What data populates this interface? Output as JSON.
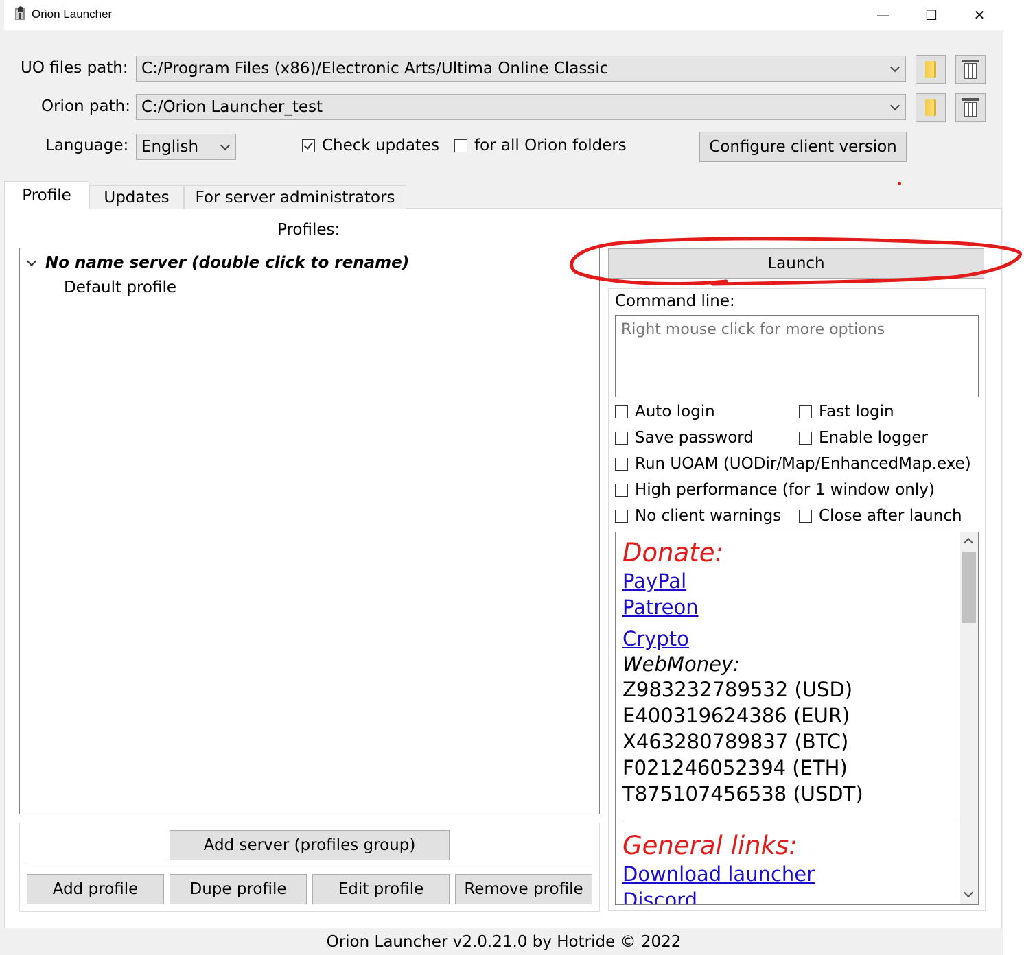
{
  "window": {
    "title": "Orion Launcher",
    "minimize_glyph": "—",
    "maximize_glyph": "☐",
    "close_glyph": "✕"
  },
  "paths": {
    "uo_label": "UO files path:",
    "uo_value": "C:/Program Files (x86)/Electronic Arts/Ultima Online Classic",
    "orion_label": "Orion path:",
    "orion_value": "C:/Orion Launcher_test",
    "browse_icon": "folder-icon",
    "clear_icon": "trash-icon"
  },
  "language": {
    "label": "Language:",
    "value": "English"
  },
  "options_top": {
    "check_updates": {
      "label": "Check updates",
      "checked": true
    },
    "all_folders": {
      "label": "for all Orion folders",
      "checked": false
    },
    "configure_label": "Configure client version"
  },
  "tabs": [
    {
      "label": "Profile",
      "active": true
    },
    {
      "label": "Updates",
      "active": false
    },
    {
      "label": "For server administrators",
      "active": false
    }
  ],
  "profiles": {
    "label": "Profiles:",
    "server_name": "No name server (double click to rename)",
    "profile_name": "Default profile"
  },
  "buttons": {
    "add_server": "Add server (profiles group)",
    "add_profile": "Add profile",
    "dupe_profile": "Dupe profile",
    "edit_profile": "Edit profile",
    "remove_profile": "Remove profile",
    "launch": "Launch"
  },
  "command_line": {
    "label": "Command line:",
    "placeholder": "Right mouse click for more options"
  },
  "launch_options": {
    "auto_login": "Auto login",
    "fast_login": "Fast login",
    "save_password": "Save password",
    "enable_logger": "Enable logger",
    "run_uoam": "Run UOAM (UODir/Map/EnhancedMap.exe)",
    "high_performance": "High performance (for 1 window only)",
    "no_client_warnings": "No client warnings",
    "close_after_launch": "Close after launch"
  },
  "info": {
    "donate_header": "Donate:",
    "paypal": "PayPal",
    "patreon": "Patreon",
    "crypto": "Crypto",
    "webmoney_label": "WebMoney:",
    "wallets": [
      "Z983232789532 (USD)",
      "E400319624386 (EUR)",
      "X463280789837 (BTC)",
      "F021246052394 (ETH)",
      "T875107456538 (USDT)"
    ],
    "general_header": "General links:",
    "download_launcher": "Download launcher",
    "discord": "Discord"
  },
  "status": {
    "text": "Orion Launcher v2.0.21.0 by Hotride © 2022"
  },
  "colors": {
    "header_red": "#e31b1b",
    "link_blue": "#1a0dcc",
    "annotation_red": "#e31b1b"
  }
}
